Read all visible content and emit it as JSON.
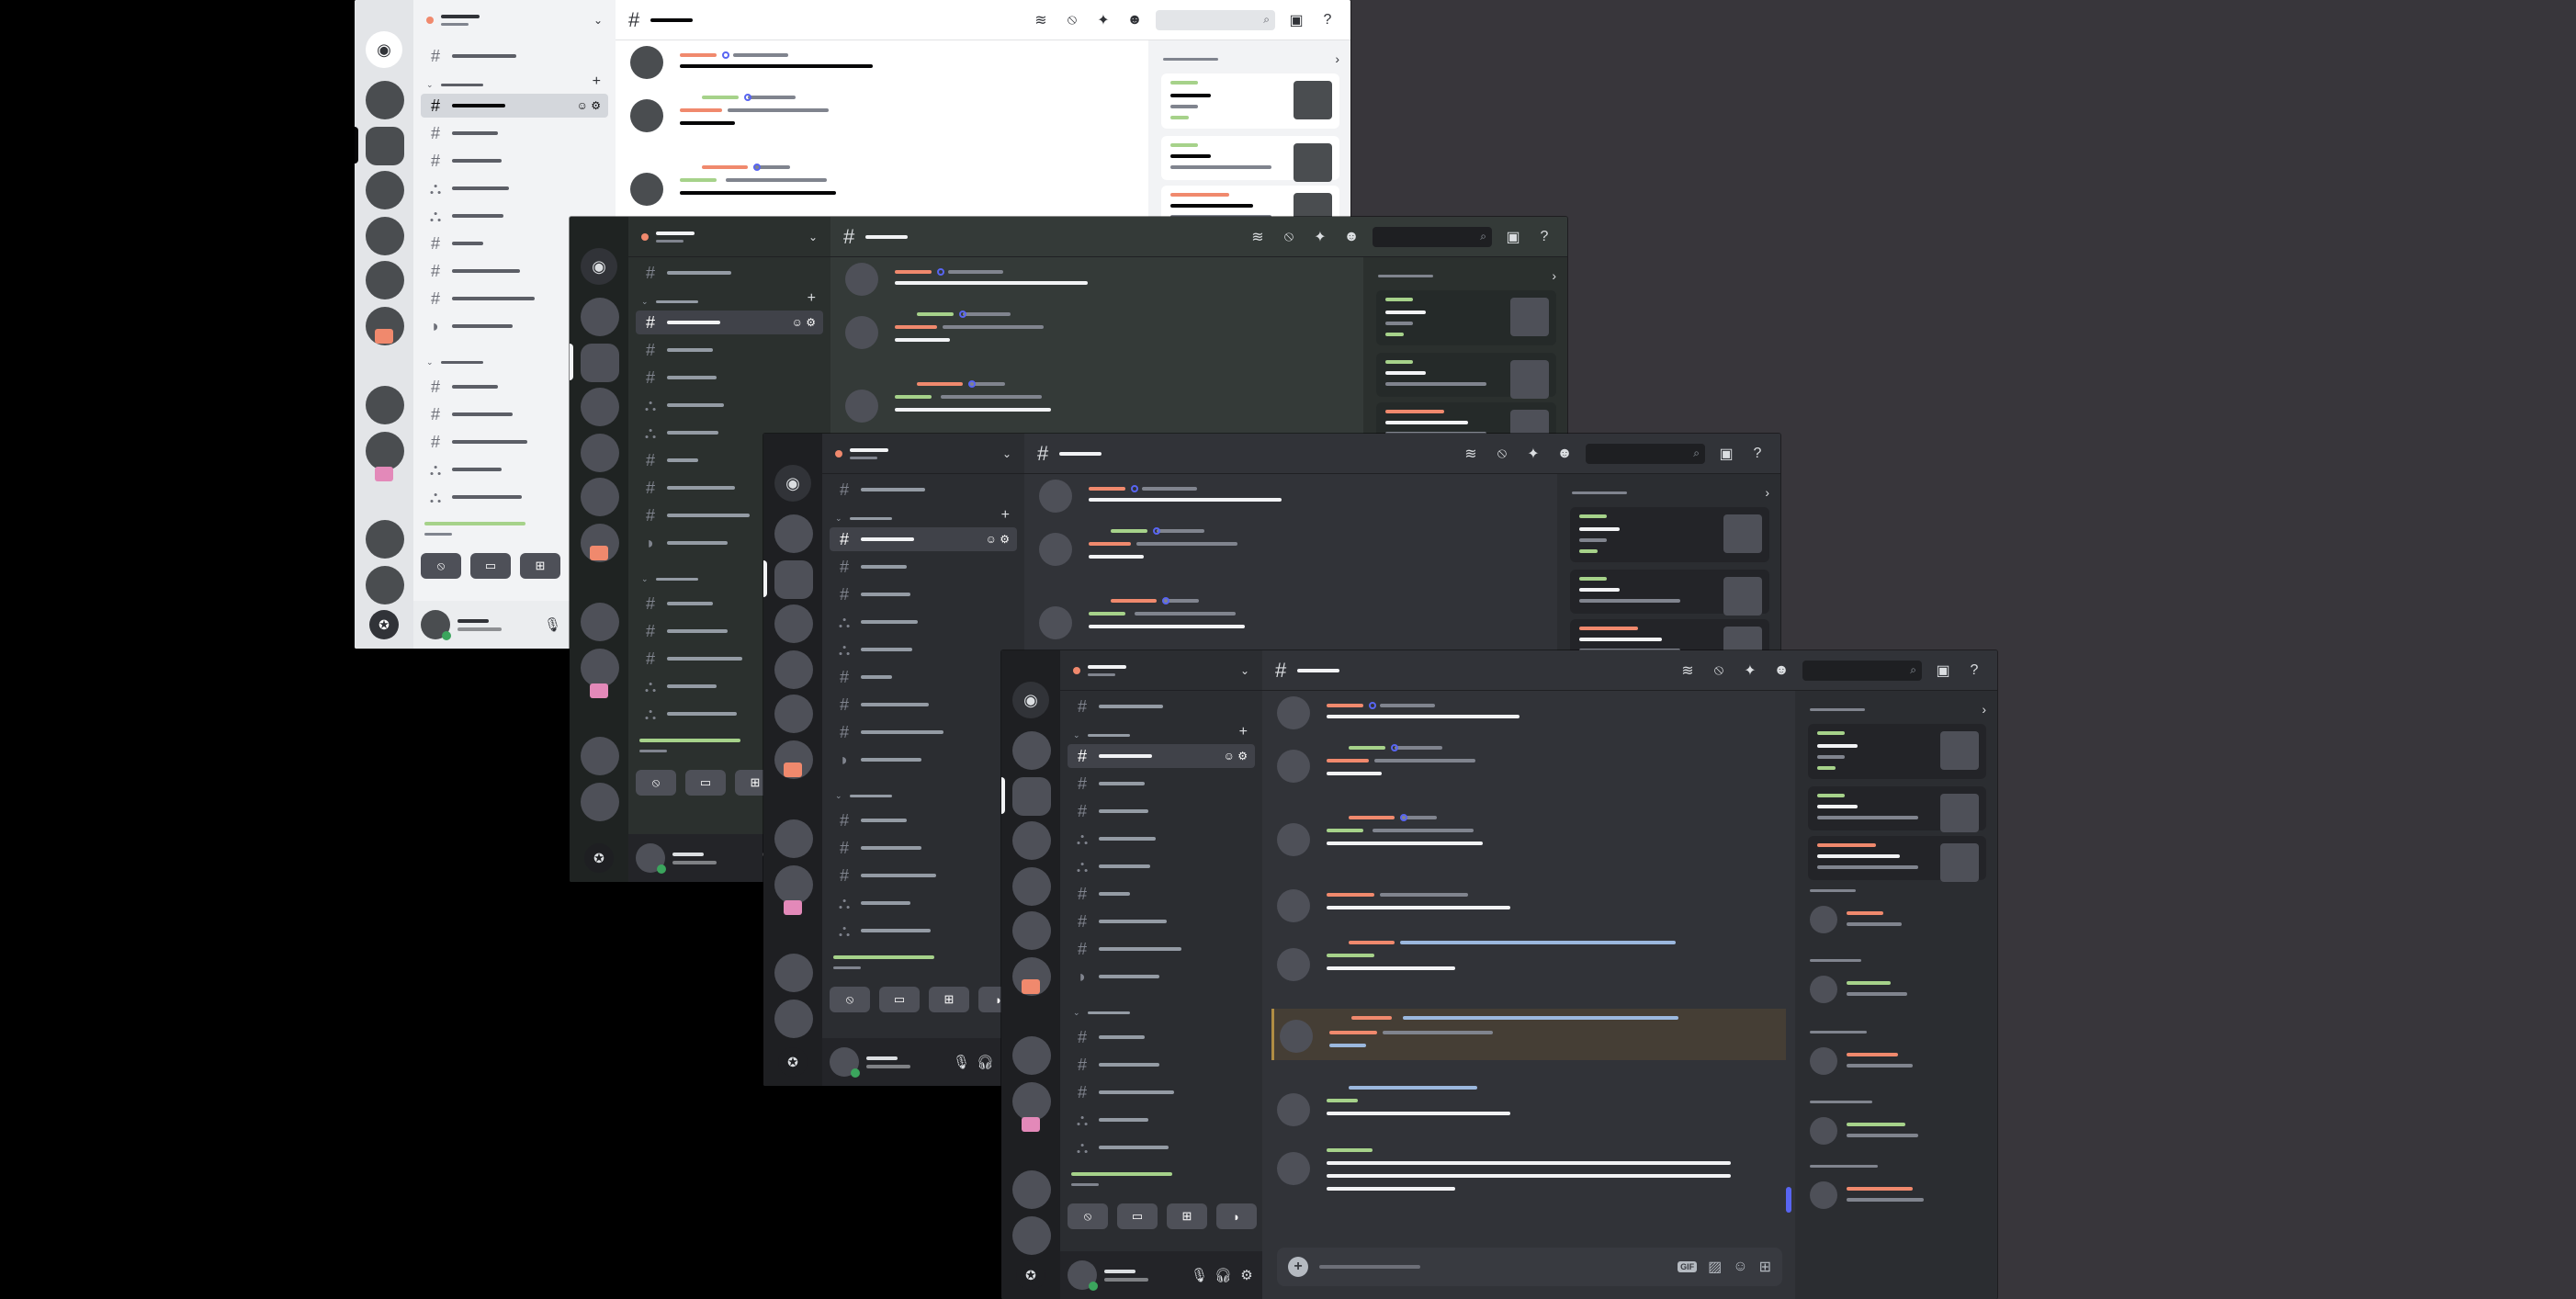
{
  "colors": {
    "accent": "#5865f2",
    "role_salmon": "#f0896d",
    "role_green": "#a6d28a",
    "online": "#3ba55d",
    "highlight_border": "#b08d43"
  },
  "icons": {
    "app": "discord-logo-icon",
    "discover": "compass-icon",
    "channel": "hash-icon",
    "forum": "forum-icon",
    "voice": "speaker-icon",
    "threads": "threads-icon",
    "mute": "bell-slash-icon",
    "pin": "pin-icon",
    "members": "members-icon",
    "search": "search-icon",
    "inbox": "inbox-icon",
    "help": "help-icon",
    "mic": "microphone-icon",
    "headphones": "headphones-icon",
    "settings": "gear-icon",
    "add": "plus-icon",
    "gif": "gif-icon",
    "sticker": "sticker-icon",
    "emoji": "emoji-icon",
    "apps": "apps-icon"
  },
  "glyphs": {
    "logo": "◉",
    "hash": "#",
    "chev": "⌄",
    "plus": "+",
    "gear": "⚙",
    "search": "⌕",
    "inbox": "▣",
    "help": "?",
    "threads": "≋",
    "mute": "⦸",
    "pin": "✦",
    "members": "☻",
    "mic": "♪",
    "headphones": "∩",
    "compass": "✪",
    "add": "+",
    "gif": "GIF",
    "sticker": "▨",
    "emoji": "☺",
    "apps": "⊞",
    "screen": "▭",
    "speaker": "◗",
    "members_card": "›"
  },
  "windows": [
    {
      "theme": "light",
      "label": "window-light"
    },
    {
      "theme": "ash",
      "label": "window-ash"
    },
    {
      "theme": "dark",
      "label": "window-dark"
    },
    {
      "theme": "onyx",
      "label": "window-onyx"
    }
  ]
}
